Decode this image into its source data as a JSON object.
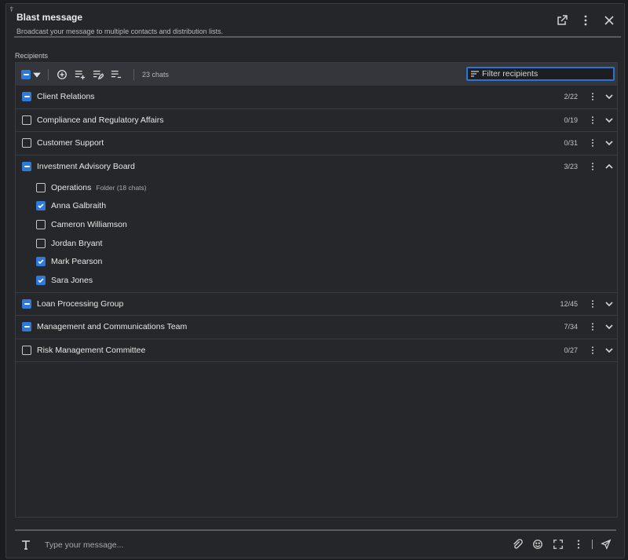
{
  "header": {
    "title": "Blast message",
    "subtitle": "Broadcast your message to multiple contacts and distribution lists."
  },
  "recipients": {
    "section_label": "Recipients",
    "chat_count": "23 chats",
    "filter_placeholder": "Filter recipients"
  },
  "groups": [
    {
      "name": "Client Relations",
      "count": "2/22",
      "state": "partial",
      "expanded": false
    },
    {
      "name": "Compliance and Regulatory Affairs",
      "count": "0/19",
      "state": "empty",
      "expanded": false
    },
    {
      "name": "Customer Support",
      "count": "0/31",
      "state": "empty",
      "expanded": false
    },
    {
      "name": "Investment Advisory Board",
      "count": "3/23",
      "state": "partial",
      "expanded": true
    },
    {
      "name": "Loan Processing Group",
      "count": "12/45",
      "state": "partial",
      "expanded": false
    },
    {
      "name": "Management and Communications Team",
      "count": "7/34",
      "state": "partial",
      "expanded": false
    },
    {
      "name": "Risk Management Committee",
      "count": "0/27",
      "state": "empty",
      "expanded": false
    }
  ],
  "expanded_children": [
    {
      "name": "Operations",
      "meta": "Folder (18 chats)",
      "checked": false
    },
    {
      "name": "Anna Galbraith",
      "checked": true
    },
    {
      "name": "Cameron Williamson",
      "checked": false
    },
    {
      "name": "Jordan Bryant",
      "checked": false
    },
    {
      "name": "Mark Pearson",
      "checked": true
    },
    {
      "name": "Sara Jones",
      "checked": true
    }
  ],
  "composer": {
    "placeholder": "Type your message..."
  },
  "colors": {
    "accent": "#2f7ad8",
    "focus_border": "#2a74d4",
    "background": "#252629",
    "toolbar": "#34363b"
  }
}
